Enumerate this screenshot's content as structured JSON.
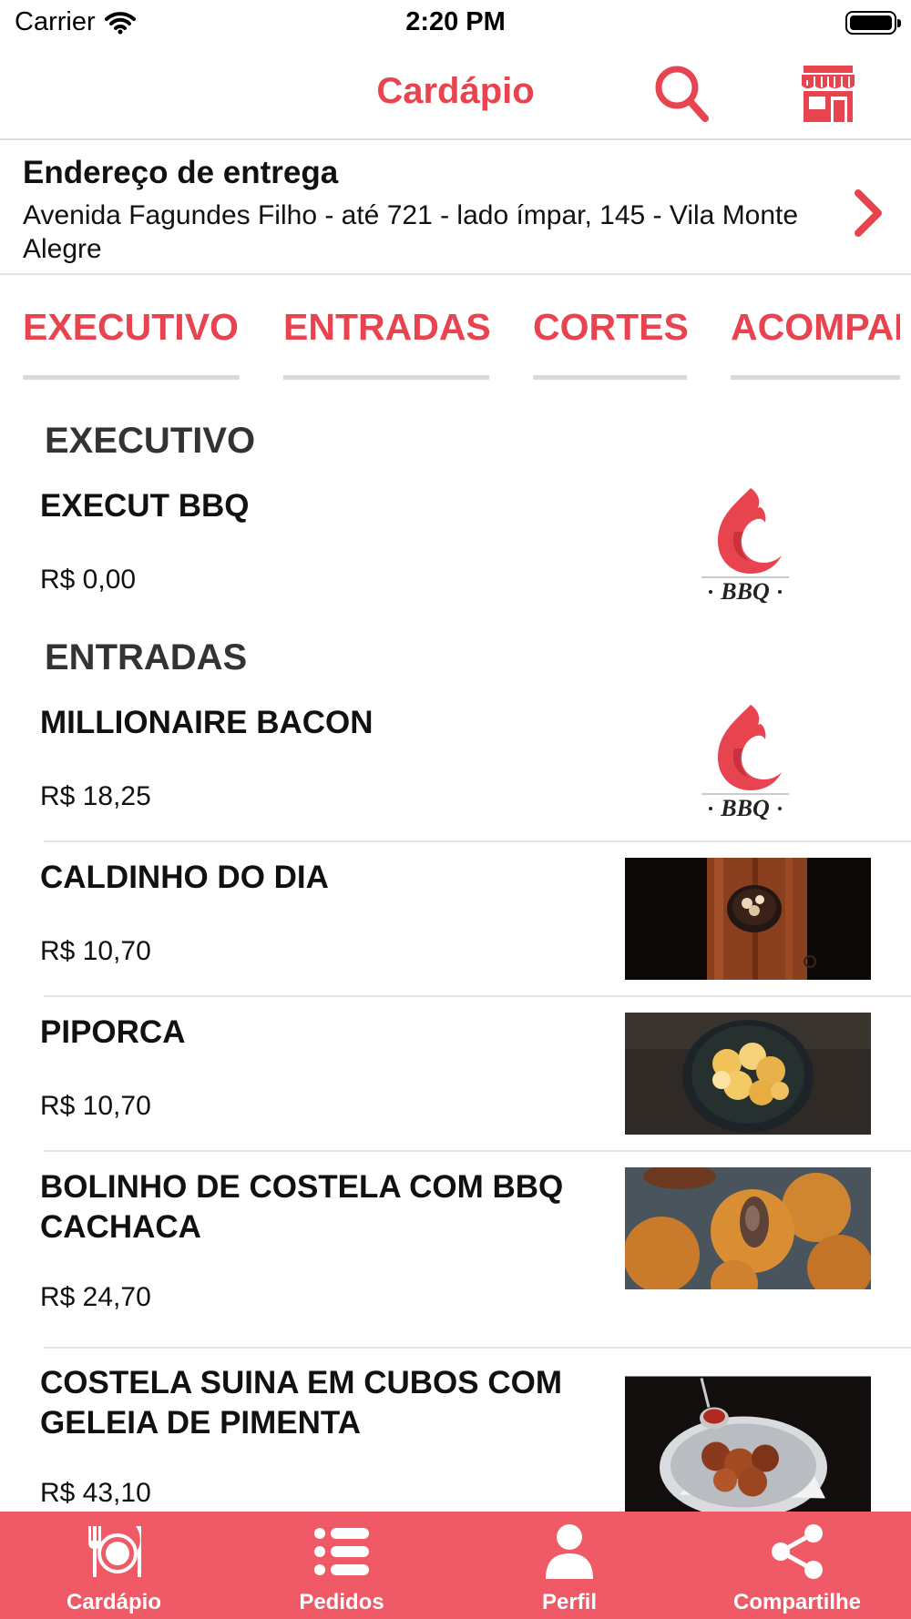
{
  "status_bar": {
    "carrier": "Carrier",
    "time": "2:20 PM"
  },
  "header": {
    "title": "Cardápio"
  },
  "address": {
    "heading": "Endereço de entrega",
    "text": "Avenida Fagundes Filho - até 721 - lado ímpar, 145  - Vila Monte Alegre"
  },
  "tabs": [
    "EXECUTIVO",
    "ENTRADAS",
    "CORTES",
    "ACOMPANHAMENTOS"
  ],
  "sections": [
    {
      "title": "EXECUTIVO",
      "items": [
        {
          "name": "EXECUT BBQ",
          "price": "R$ 0,00",
          "image": "bbq-logo"
        }
      ]
    },
    {
      "title": "ENTRADAS",
      "items": [
        {
          "name": "MILLIONAIRE BACON",
          "price": "R$ 18,25",
          "image": "bbq-logo"
        },
        {
          "name": "CALDINHO DO DIA",
          "price": "R$ 10,70",
          "image": "soup-photo"
        },
        {
          "name": "PIPORCA",
          "price": "R$ 10,70",
          "image": "pork-crackling-photo"
        },
        {
          "name": "BOLINHO DE COSTELA COM BBQ CACHACA",
          "price": "R$ 24,70",
          "image": "croquette-photo"
        },
        {
          "name": "COSTELA SUINA EM CUBOS COM GELEIA DE PIMENTA",
          "price": "R$ 43,10",
          "image": "pork-ribs-photo"
        }
      ]
    }
  ],
  "logo_text": "BBQ",
  "tabbar": [
    {
      "label": "Cardápio",
      "icon": "cutlery-plate-icon"
    },
    {
      "label": "Pedidos",
      "icon": "list-icon"
    },
    {
      "label": "Perfil",
      "icon": "person-icon"
    },
    {
      "label": "Compartilhe",
      "icon": "share-icon"
    }
  ],
  "colors": {
    "accent": "#e8444f",
    "tabbar": "#ef5a66",
    "divider": "#e4e4e4"
  }
}
